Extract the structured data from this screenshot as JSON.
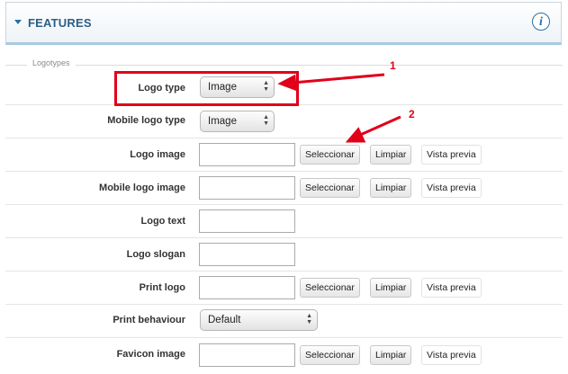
{
  "header": {
    "title": "FEATURES",
    "info_icon": "info-icon"
  },
  "fieldset": {
    "legend": "Logotypes"
  },
  "buttons": {
    "select": "Seleccionar",
    "clear": "Limpiar",
    "preview": "Vista previa"
  },
  "fields": {
    "logo_type": {
      "label": "Logo type",
      "value": "Image"
    },
    "mobile_logo_type": {
      "label": "Mobile logo type",
      "value": "Image"
    },
    "logo_image": {
      "label": "Logo image"
    },
    "mobile_logo_image": {
      "label": "Mobile logo image"
    },
    "logo_text": {
      "label": "Logo text"
    },
    "logo_slogan": {
      "label": "Logo slogan"
    },
    "print_logo": {
      "label": "Print logo"
    },
    "print_behaviour": {
      "label": "Print behaviour",
      "value": "Default"
    },
    "favicon_image": {
      "label": "Favicon image"
    }
  },
  "annotations": {
    "callout_1": "1",
    "callout_2": "2",
    "highlight_color": "#e0001a"
  }
}
